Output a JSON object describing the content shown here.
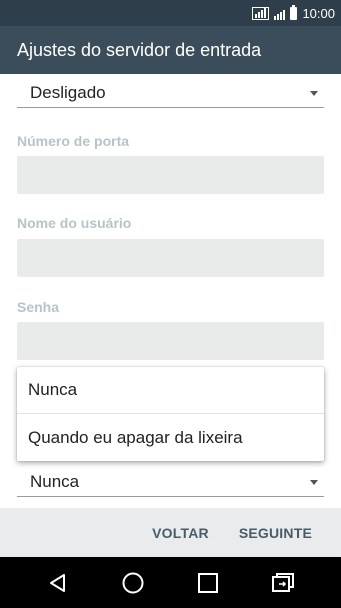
{
  "status_bar": {
    "time": "10:00",
    "icons": [
      "signal-icon-1",
      "signal-icon-2",
      "battery-icon"
    ]
  },
  "app_bar": {
    "title": "Ajustes do servidor de entrada"
  },
  "form": {
    "security_spinner": {
      "value": "Desligado",
      "icon": "chevron-down-icon"
    },
    "port_label": "Número de porta",
    "port_value": "",
    "username_label": "Nome do usuário",
    "username_value": "",
    "password_label": "Senha",
    "password_value": "",
    "delete_spinner": {
      "value": "Nunca",
      "icon": "chevron-down-icon"
    }
  },
  "popup": {
    "options": [
      "Nunca",
      "Quando eu apagar da lixeira"
    ]
  },
  "bottom_bar": {
    "back_label": "VOLTAR",
    "next_label": "SEGUINTE"
  },
  "nav_bar": {
    "icons": [
      "back-triangle-icon",
      "home-circle-icon",
      "recents-square-icon",
      "switch-app-icon"
    ]
  },
  "colors": {
    "status_bar": "#2e3e4b",
    "app_bar": "#3b4d5b",
    "label": "#b8c3c8",
    "field_bg": "#e9eaea",
    "bottom_bar_bg": "#e9ebec",
    "button_text": "#4a5c6a"
  }
}
